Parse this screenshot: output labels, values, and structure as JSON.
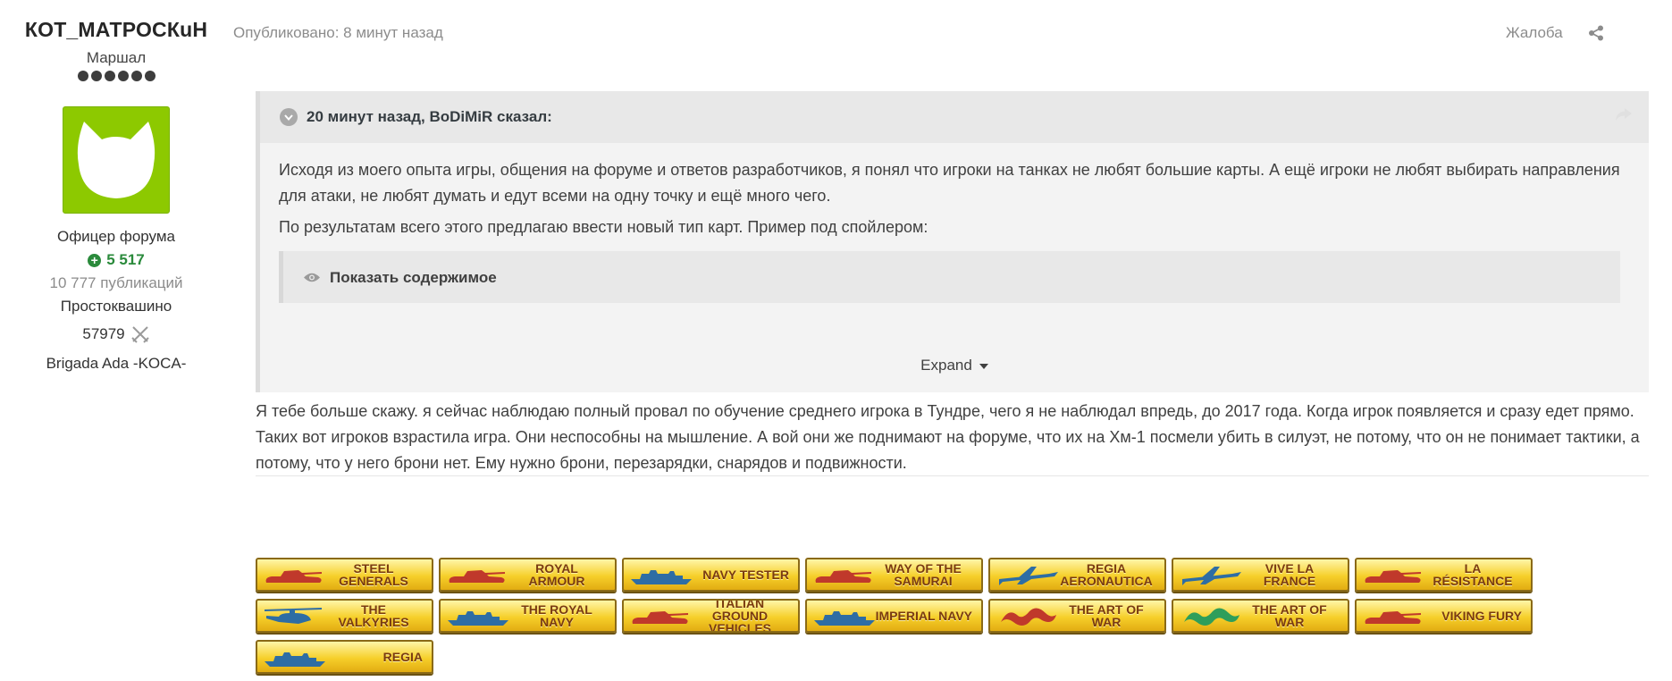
{
  "author": {
    "name": "КОТ_МАТРОСКuН",
    "rank": "Маршал",
    "pips": 6,
    "role": "Офицер форума",
    "reputation": "5 517",
    "posts": "10 777 публикаций",
    "location": "Простоквашино",
    "score": "57979",
    "clan": "Brigada Ada -KOCA-"
  },
  "post": {
    "published": "Опубликовано: 8 минут назад",
    "report": "Жалоба"
  },
  "quote": {
    "citation": "20 минут назад, BoDiMiR сказал:",
    "paragraphs": [
      "Исходя из моего опыта игры, общения на форуме и ответов разработчиков, я понял что игроки на танках не любят большие карты. А ещё игроки не любят выбирать направления для атаки, не любят думать и едут всеми на одну точку и ещё много чего.",
      "По результатам всего этого предлагаю ввести новый тип карт. Пример под спойлером:"
    ],
    "spoiler_label": "Показать содержимое",
    "expand_label": "Expand"
  },
  "reply": {
    "text": "Я тебе больше скажу. я сейчас наблюдаю полный провал по обучение среднего игрока в Тундре, чего я не наблюдал впредь, до 2017 года. Когда игрок появляется и сразу едет прямо. Таких вот игроков взрастила игра. Они неспособны на мышление. А вой они же поднимают на форуме, что их на Хм-1 посмели убить в силуэт, не потому, что он не понимает тактики, а потому, что у него брони нет. Ему нужно брони, перезарядки, снарядов и подвижности."
  },
  "badges": {
    "row1": [
      {
        "label": "STEEL GENERALS",
        "icon": "tank-icon",
        "color": "#c0392b"
      },
      {
        "label": "ROYAL ARMOUR",
        "icon": "tank-icon",
        "color": "#c0392b"
      },
      {
        "label": "NAVY TESTER",
        "icon": "ship-icon",
        "color": "#2e6da4"
      },
      {
        "label": "WAY OF THE SAMURAI",
        "icon": "tank-icon",
        "color": "#c0392b"
      },
      {
        "label": "REGIA AERONAUTICA",
        "icon": "plane-icon",
        "color": "#2e6da4"
      },
      {
        "label": "VIVE LA FRANCE",
        "icon": "plane-icon",
        "color": "#2e6da4"
      },
      {
        "label": "LA RÉSISTANCE",
        "icon": "tank-icon",
        "color": "#c0392b"
      }
    ],
    "row2": [
      {
        "label": "THE VALKYRIES",
        "icon": "helicopter-icon",
        "color": "#2e6da4"
      },
      {
        "label": "THE ROYAL NAVY",
        "icon": "ship-icon",
        "color": "#2e6da4"
      },
      {
        "label": "ITALIAN GROUND VEHICLES",
        "icon": "tank-icon",
        "color": "#c0392b"
      },
      {
        "label": "IMPERIAL NAVY",
        "icon": "ship-icon",
        "color": "#2e6da4"
      },
      {
        "label": "THE ART OF WAR",
        "icon": "dragon-icon",
        "color": "#c0392b"
      },
      {
        "label": "THE ART OF WAR",
        "icon": "dragon-icon",
        "color": "#2e9e5b"
      },
      {
        "label": "VIKING FURY",
        "icon": "tank-icon",
        "color": "#c0392b"
      }
    ],
    "row3": [
      {
        "label": "REGIA",
        "icon": "ship-icon",
        "color": "#2e6da4"
      }
    ]
  }
}
